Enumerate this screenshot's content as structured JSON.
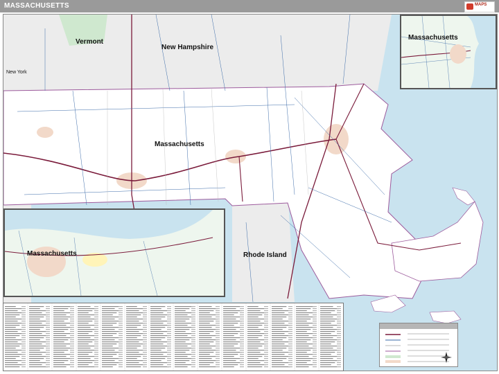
{
  "header": {
    "title": "MASSACHUSETTS",
    "brand_color": "#9a9a9a"
  },
  "map": {
    "labels": {
      "vermont": "Vermont",
      "new_hampshire": "New Hampshire",
      "new_york": "New York",
      "massachusetts": "Massachusetts",
      "rhode_island": "Rhode Island"
    },
    "colors": {
      "water": "#c9e3ef",
      "land_primary": "#ffffff",
      "land_neighbor": "#ececec",
      "forest": "#cfe8cf",
      "urban": "#f2d9c9",
      "highway": "#7a1a3a",
      "road": "#3a6aa8"
    }
  },
  "insets": [
    {
      "label": "Massachusetts"
    },
    {
      "label": "Massachusetts"
    }
  ],
  "index": {
    "columns": 14
  },
  "legend": {
    "title": ""
  },
  "icons": [
    "logo-icon",
    "compass-icon"
  ]
}
